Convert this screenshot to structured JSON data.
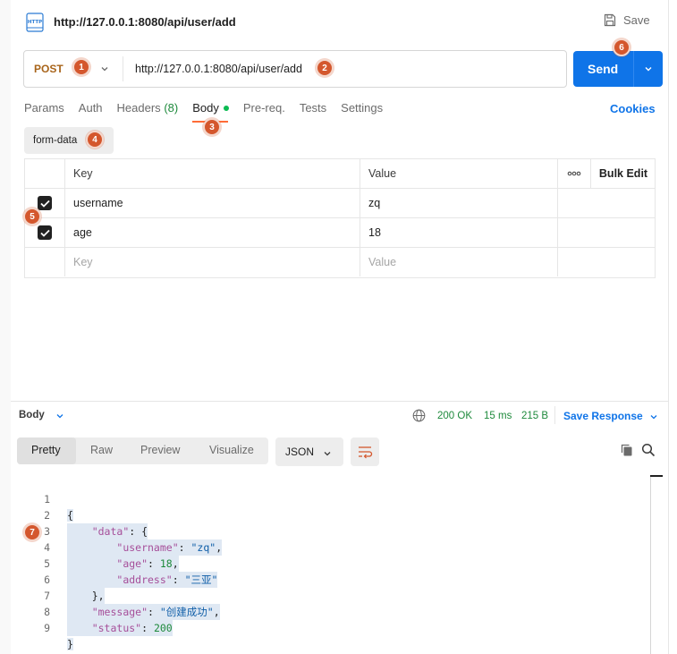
{
  "header": {
    "title": "http://127.0.0.1:8080/api/user/add",
    "save_label": "Save",
    "request_icon": "http-icon"
  },
  "request": {
    "method": "POST",
    "url": "http://127.0.0.1:8080/api/user/add",
    "send_label": "Send"
  },
  "tabs": [
    {
      "label": "Params"
    },
    {
      "label": "Auth"
    },
    {
      "label": "Headers",
      "count": "(8)"
    },
    {
      "label": "Body",
      "active": true
    },
    {
      "label": "Pre-req."
    },
    {
      "label": "Tests"
    },
    {
      "label": "Settings"
    }
  ],
  "cookies_label": "Cookies",
  "body_type": "form-data",
  "params_table": {
    "headers": {
      "key": "Key",
      "value": "Value",
      "more": "ooo",
      "bulk": "Bulk Edit"
    },
    "rows": [
      {
        "checked": true,
        "key": "username",
        "value": "zq"
      },
      {
        "checked": true,
        "key": "age",
        "value": "18"
      }
    ],
    "placeholder": {
      "key": "Key",
      "value": "Value"
    }
  },
  "response": {
    "section_label": "Body",
    "status": "200 OK",
    "time": "15 ms",
    "size": "215 B",
    "save_response_label": "Save Response",
    "view_tabs": [
      "Pretty",
      "Raw",
      "Preview",
      "Visualize"
    ],
    "active_view": "Pretty",
    "format": "JSON",
    "line_numbers": [
      "1",
      "2",
      "3",
      "4",
      "5",
      "6",
      "7",
      "8",
      "9"
    ],
    "json_text": {
      "l1": "{",
      "l2_key": "\"data\"",
      "l2_rest": ": {",
      "l3_key": "\"username\"",
      "l3_sep": ": ",
      "l3_val": "\"zq\"",
      "l3_end": ",",
      "l4_key": "\"age\"",
      "l4_sep": ": ",
      "l4_val": "18",
      "l4_end": ",",
      "l5_key": "\"address\"",
      "l5_sep": ": ",
      "l5_val": "\"三亚\"",
      "l6": "},",
      "l7_key": "\"message\"",
      "l7_sep": ": ",
      "l7_val": "\"创建成功\"",
      "l7_end": ",",
      "l8_key": "\"status\"",
      "l8_sep": ": ",
      "l8_val": "200",
      "l9": "}"
    }
  },
  "annotations": [
    "1",
    "2",
    "3",
    "4",
    "5",
    "6",
    "7"
  ],
  "colors": {
    "accent": "#0f74e8",
    "method": "#a8641a",
    "badge": "#d4572d",
    "status_ok": "#1e8a3c",
    "body_dot": "#0cbb52"
  }
}
